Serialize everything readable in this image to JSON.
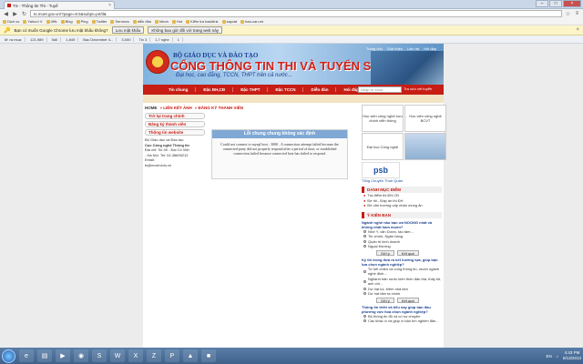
{
  "browser": {
    "tab_title": "TS - Thông tin Thi - Tuyể",
    "url": "ts.moet.gov.vn/?page=9.5&subpt=pri/tl&",
    "bookmarks": [
      "Dịch vụ",
      "Yahoo! V",
      "Jiffs",
      "Blog",
      "Ping",
      "Twitter",
      "Services",
      "diễn đàn",
      "Mech",
      "Hot",
      "Kiểm tra backlink",
      "sayvat",
      "ban-can-ne"
    ],
    "infobar_text": "Bạn có muốn Google Chrome lưu mật khẩu không?",
    "infobar_save": "Lưu mật khẩu",
    "infobar_never": "Không bao giờ đối với trang web này",
    "tabs_row": [
      "M: ra mua:",
      "121,989",
      "5d0",
      "1,849",
      "Bạc December 4...",
      "3,000",
      "Tin 3",
      "1,7 nghe",
      "1"
    ]
  },
  "site": {
    "topnav": [
      "Trang chủ",
      "Giới thiệu",
      "Liên hệ",
      "Hỏi đáp"
    ],
    "ministry": "BỘ GIÁO DỤC VÀ ĐÀO TẠO",
    "portal": "CỔNG THÔNG TIN THI VÀ TUYỂN SINH",
    "tagline": "Đại học, cao đẳng, TCCN, THPT trên cả nước...",
    "menu": [
      "Tin chung",
      "Đặc ĐH,CĐ",
      "Đặc THPT",
      "Đặc TCCN",
      "Diễn đàn",
      "Hỏi đáp"
    ],
    "search_placeholder": "Nhập từ khóa",
    "search_button": "Tra cứu xét tuyển",
    "breadcrumb": {
      "home": "HOME",
      "crumbs": [
        "» LIÊN KẾT ẢNH",
        "» ĐĂNG KÝ THÀNH VIÊN"
      ]
    },
    "left_buttons": [
      "Trở lại trang chính",
      "Đăng ký thành viên",
      "Thông tin website"
    ],
    "contact": [
      "Bộ Giáo dục và Đào tạo",
      "Cục Công nghệ Thông tin",
      "Địa chỉ: Số 49 - Đại Cồ Việt",
      "- Hà Nội. Tel: 04.38695212",
      "Email:",
      "ts@moet.edu.vn"
    ],
    "message_title": "Lỗi chung chung không xác định",
    "message_body": "Could not connect to mysql host : 3000 . A connection attempt failed because the connected party did not properly respond after a period of time, or established connection failed because connected host has failed to respond.",
    "ads": [
      "Học viện công nghệ bưu chính viễn thông",
      "Học viện công nghệ BCVT",
      "Đại học Công nghệ",
      ""
    ],
    "psb": {
      "logo": "psb",
      "caption": "Tổng Chuyên Thuê Quản"
    },
    "panel1_title": "DANH MỤC ĐIỂM",
    "panel1_links": [
      "Tra điểm thi ĐH,CĐ",
      "Đề thi - Đáp án thi ĐH",
      "Đề văn trường cấp nhận mùng ăn"
    ],
    "panel2_title": "Ý KIẾN BẠN",
    "poll1_q": "Ngành nghề nào bạn ưa NOONG nhất và không nhất ham muốn?",
    "poll1_opts": [
      "Nhớ Y, văn Dược, tạo tâm...",
      "Tin chính, Ngân hàng",
      "Quản trị kinh doanh",
      "Ngoại thương"
    ],
    "poll2_q": "Kỳ thi trong đưa ra kết hướng tựa, giúp bạn lựa chọn ngành nghiệp?",
    "poll2_opts": [
      "Từ kết chiều và cùng thông tin, muốn ngành nghề định...",
      "Nghành bản nước kiến thôn đấu thà, thấy tôi, anh chị...",
      "Dự hat lui, thêm nhà làm",
      "Dự hat tăm ta chinh"
    ],
    "poll3_q": "Thông tin triển và tiểu nay giúp bạn đầu phương vực hoạ chọn ngành nghiệp?",
    "poll3_opts": [
      "Bộ thông tin đủ và có sự chuyện",
      "Các khác vì và giúp vì bận tìm nghiên lắm..."
    ],
    "vote": "Gửi ý",
    "results": "Kết quả"
  },
  "taskbar": {
    "apps": [
      "ie",
      "folder",
      "media",
      "chrome",
      "skype",
      "word",
      "excel",
      "ftp",
      "ps",
      "vlc",
      "app"
    ],
    "lang": "EN",
    "time": "4:43 PM",
    "date": "8/13/2013"
  }
}
